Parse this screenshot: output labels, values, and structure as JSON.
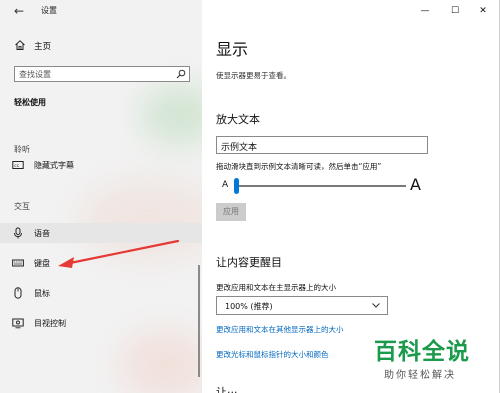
{
  "window": {
    "title": "设置",
    "caption_buttons": {
      "minimize": "—",
      "maximize": "☐",
      "close": "✕"
    }
  },
  "sidebar": {
    "back_icon": "←",
    "home_label": "主页",
    "search_placeholder": "查找设置",
    "section_title": "轻松使用",
    "groups": [
      {
        "label": "聆听",
        "items": [
          {
            "label": "隐藏式字幕",
            "icon": "closed-caption-icon"
          }
        ]
      },
      {
        "label": "交互",
        "items": [
          {
            "label": "语音",
            "icon": "microphone-icon"
          },
          {
            "label": "键盘",
            "icon": "keyboard-icon"
          },
          {
            "label": "鼠标",
            "icon": "mouse-icon"
          },
          {
            "label": "目视控制",
            "icon": "eye-control-icon"
          }
        ]
      }
    ]
  },
  "main": {
    "title": "显示",
    "description": "使显示器更易于查看。",
    "enlarge_text": {
      "heading": "放大文本",
      "sample_value": "示例文本",
      "hint": "拖动滑块直到示例文本清晰可读，然后单击“应用”",
      "small_label": "A",
      "large_label": "A",
      "level": 0.0,
      "apply_label": "应用"
    },
    "make_bigger": {
      "heading": "让内容更醒目",
      "scale_label": "更改应用和文本在主显示器上的大小",
      "scale_value": "100% (推荐)",
      "links": [
        "更改应用和文本在其他显示器上的大小",
        "更改光标和鼠标指针的大小和颜色"
      ],
      "next_heading_partial": "让···"
    }
  },
  "watermark": {
    "title": "百科全说",
    "subtitle": "助你轻松解决"
  },
  "colors": {
    "accent": "#0078d7",
    "link": "#0067c0",
    "sidebar_bg": "#f2f2f2",
    "annotation_arrow": "#e53935",
    "watermark_green": "#1a9a4a"
  }
}
